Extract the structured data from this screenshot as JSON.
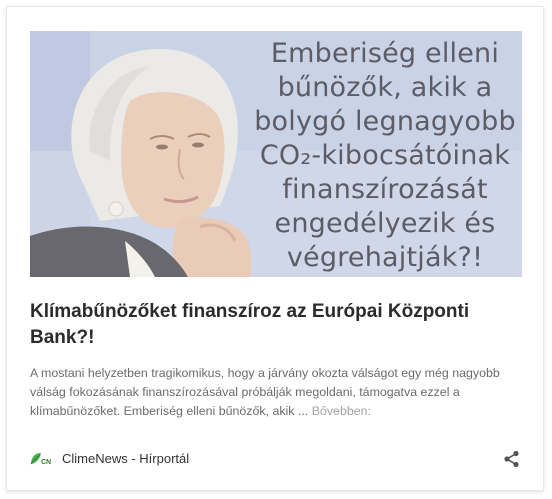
{
  "post": {
    "image": {
      "overlay_lines": [
        "Emberiség elleni",
        "bűnözők, akik a",
        "bolygó legnagyobb",
        "CO₂-kibocsátóinak",
        "finanszírozását",
        "engedélyezik és",
        "végrehajtják?!"
      ]
    },
    "title": "Klímabűnözőket finanszíroz az Európai Központi Bank?!",
    "excerpt": "A mostani helyzetben tragikomikus, hogy a járvány okozta válságot egy még nagyobb válság fokozásának finanszírozásával próbálják megoldani, támogatva ezzel a klímabűnözőket. Emberiség elleni bűnözők, akik ...",
    "read_more": "Bővebben:",
    "source": {
      "logo_text": "CN",
      "name": "ClimeNews - Hírportál",
      "logo_color": "#4caf50"
    },
    "share_icon": "share-icon"
  }
}
